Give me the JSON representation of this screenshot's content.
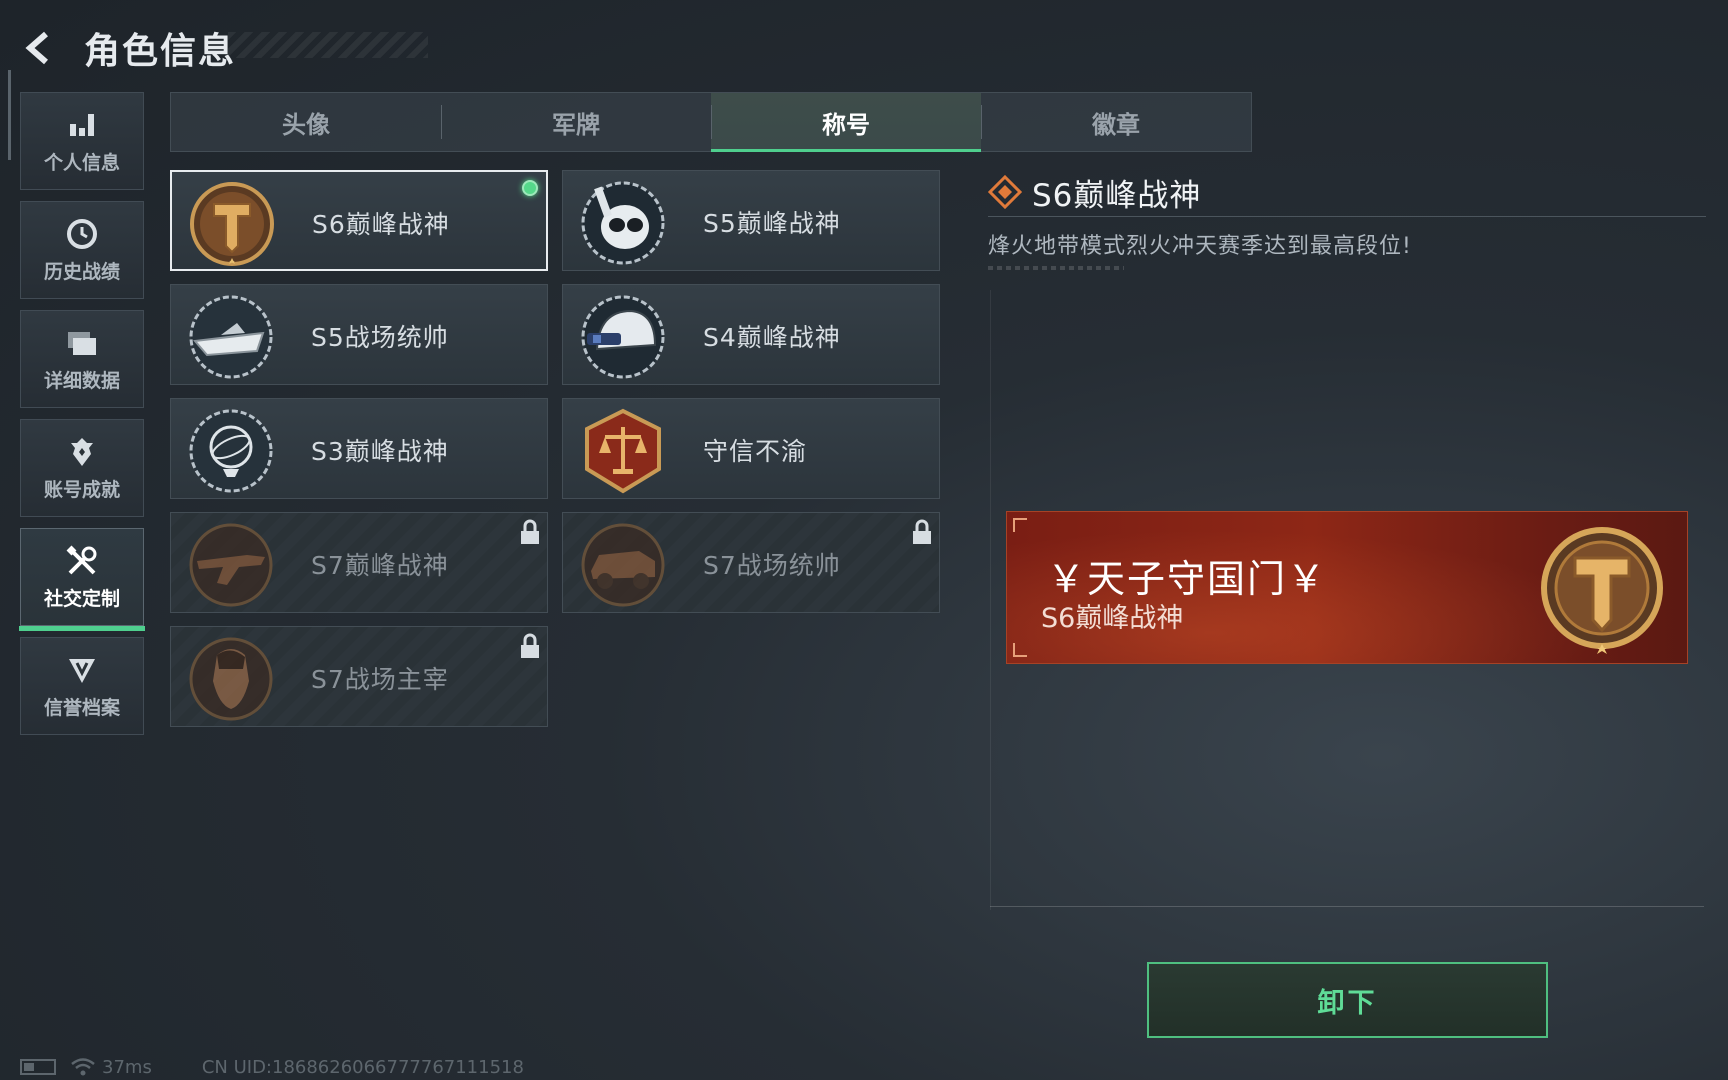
{
  "header": {
    "title": "角色信息"
  },
  "sidebar": {
    "items": [
      {
        "label": "个人信息",
        "icon": "bar-chart-icon",
        "active": false
      },
      {
        "label": "历史战绩",
        "icon": "clock-icon",
        "active": false
      },
      {
        "label": "详细数据",
        "icon": "folder-icon",
        "active": false
      },
      {
        "label": "账号成就",
        "icon": "achievement-icon",
        "active": false
      },
      {
        "label": "社交定制",
        "icon": "tools-icon",
        "active": true
      },
      {
        "label": "信誉档案",
        "icon": "credit-icon",
        "active": false
      }
    ]
  },
  "tabs": [
    {
      "label": "头像",
      "active": false
    },
    {
      "label": "军牌",
      "active": false
    },
    {
      "label": "称号",
      "active": true
    },
    {
      "label": "徽章",
      "active": false
    }
  ],
  "titles": [
    {
      "label": "S6巅峰战神",
      "medal": "t-shield-medal-icon",
      "selected": true,
      "equipped": true,
      "locked": false
    },
    {
      "label": "S5巅峰战神",
      "medal": "skull-diver-medal-icon",
      "selected": false,
      "equipped": false,
      "locked": false
    },
    {
      "label": "S5战场统帅",
      "medal": "speedboat-medal-icon",
      "selected": false,
      "equipped": false,
      "locked": false
    },
    {
      "label": "S4巅峰战神",
      "medal": "helmet-medal-icon",
      "selected": false,
      "equipped": false,
      "locked": false
    },
    {
      "label": "S3巅峰战神",
      "medal": "globe-medal-icon",
      "selected": false,
      "equipped": false,
      "locked": false
    },
    {
      "label": "守信不渝",
      "medal": "scales-medal-icon",
      "selected": false,
      "equipped": false,
      "locked": false
    },
    {
      "label": "S7巅峰战神",
      "medal": "rifle-medal-icon",
      "selected": false,
      "equipped": false,
      "locked": true
    },
    {
      "label": "S7战场统帅",
      "medal": "vehicle-medal-icon",
      "selected": false,
      "equipped": false,
      "locked": true
    },
    {
      "label": "S7战场主宰",
      "medal": "portrait-medal-icon",
      "selected": false,
      "equipped": false,
      "locked": true
    }
  ],
  "detail": {
    "title": "S6巅峰战神",
    "description": "烽火地带模式烈火冲天赛季达到最高段位!",
    "preview": {
      "player_name": "￥天子守国门￥",
      "title": "S6巅峰战神"
    }
  },
  "actions": {
    "unequip_label": "卸下"
  },
  "status": {
    "ping": "37ms",
    "uid": "CN UID:1868626066777767111518"
  },
  "colors": {
    "accent": "#4fcf8e",
    "medal_gold": "#c99a55",
    "banner_red": "#8e2716"
  }
}
